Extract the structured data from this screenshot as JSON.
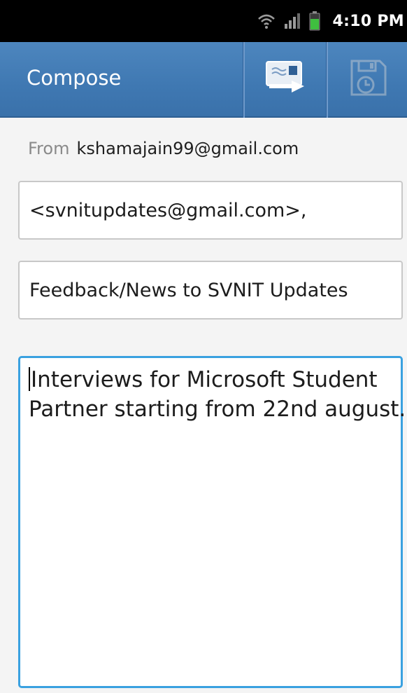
{
  "status_bar": {
    "time": "4:10 PM",
    "icons": [
      "wifi-icon",
      "signal-icon",
      "battery-icon"
    ],
    "battery_color": "#3fbf3f"
  },
  "action_bar": {
    "title": "Compose",
    "background": "#3f78b2",
    "actions": [
      {
        "name": "send",
        "icon": "send-icon",
        "enabled": true
      },
      {
        "name": "save-draft",
        "icon": "save-draft-icon",
        "enabled": false
      }
    ]
  },
  "compose": {
    "from_label": "From",
    "from_value": "kshamajain99@gmail.com",
    "to_value": "<svnitupdates@gmail.com>,",
    "subject_value": "Feedback/News to SVNIT Updates",
    "body_lines": [
      "Interviews for Microsoft Student",
      "Partner starting from 22nd august."
    ],
    "focus_color": "#3aa1e0"
  }
}
